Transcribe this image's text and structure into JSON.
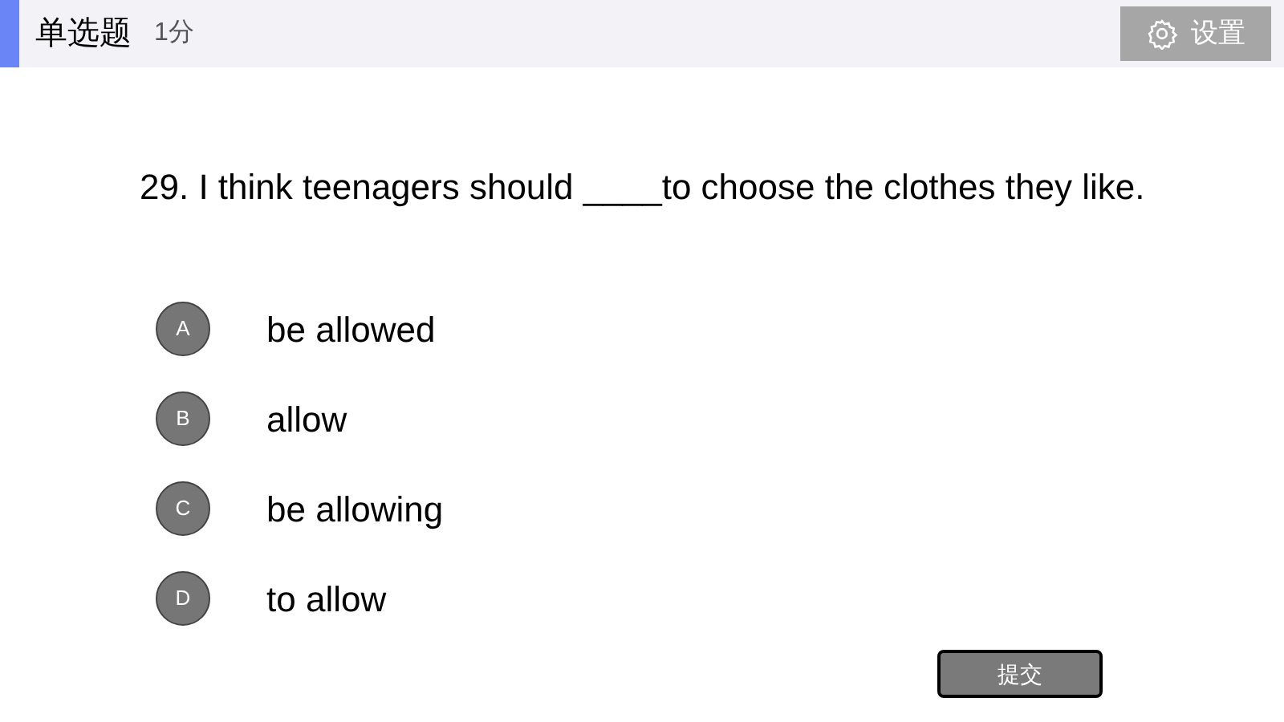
{
  "header": {
    "title": "单选题",
    "score": "1分",
    "settings_button": "设置"
  },
  "question": "29. I think teenagers should ____to choose the clothes they like.",
  "options": [
    {
      "letter": "A",
      "text": "be allowed"
    },
    {
      "letter": "B",
      "text": "allow"
    },
    {
      "letter": "C",
      "text": "be allowing"
    },
    {
      "letter": "D",
      "text": "to allow"
    }
  ],
  "submit_button": "提交"
}
